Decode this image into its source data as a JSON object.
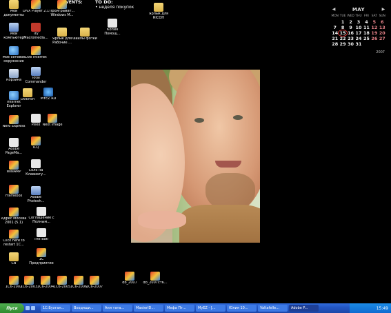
{
  "desktop": {
    "events_label": "EVENTS:",
    "todo_title": "TO DO:",
    "todo_item": "• неделя покупок",
    "icons": [
      {
        "label": "Мои документы",
        "name": "my-documents-icon",
        "type": "folder"
      },
      {
        "label": "DivX Player 2.1",
        "name": "divx-player-icon",
        "type": "app"
      },
      {
        "label": "Проигрыват... Windows M...",
        "name": "windows-media-player-icon",
        "type": "app"
      },
      {
        "label": "Мой компьютер",
        "name": "my-computer-icon",
        "type": "pc"
      },
      {
        "label": "Try Macromedia...",
        "name": "macromedia-icon",
        "type": "red"
      },
      {
        "label": "Ярлык для Рабочие ...",
        "name": "work-folder-shortcut-icon",
        "type": "folder"
      },
      {
        "label": "Файлы фотки",
        "name": "photos-folder-icon",
        "type": "folder"
      },
      {
        "label": "Копия Помощ...",
        "name": "help-copy-icon",
        "type": "doc"
      },
      {
        "label": "Ярлык для RICOH",
        "name": "ricoh-shortcut-icon",
        "type": "folder"
      },
      {
        "label": "Мое сетевое окружение",
        "name": "network-places-icon",
        "type": "net"
      },
      {
        "label": "Live Internet",
        "name": "live-internet-icon",
        "type": "app"
      },
      {
        "label": "Корзина",
        "name": "recycle-bin-icon",
        "type": "bin"
      },
      {
        "label": "Total Commander",
        "name": "total-commander-icon",
        "type": "pc"
      },
      {
        "label": "Internet Explorer",
        "name": "internet-explorer-icon",
        "type": "net"
      },
      {
        "label": "Dvalnch",
        "name": "dvalnch-folder-icon",
        "type": "folder"
      },
      {
        "label": "MYEZ RU",
        "name": "myez-icon",
        "type": "mac"
      },
      {
        "label": "Nero Express",
        "name": "nero-express-icon",
        "type": "app"
      },
      {
        "label": "Pillex",
        "name": "pillex-icon",
        "type": "doc"
      },
      {
        "label": "Next Image",
        "name": "next-image-icon",
        "type": "app"
      },
      {
        "label": "Adobe PageMa...",
        "name": "adobe-pagemaker-icon",
        "type": "doc"
      },
      {
        "label": "ICQ",
        "name": "icq-icon",
        "type": "app"
      },
      {
        "label": "WINAMP",
        "name": "winamp-icon",
        "type": "app"
      },
      {
        "label": "Соло на Клавиату...",
        "name": "solo-keyboard-icon",
        "type": "doc"
      },
      {
        "label": "Framebox",
        "name": "framebox-icon",
        "type": "app"
      },
      {
        "label": "Adobe Photosh...",
        "name": "adobe-photoshop-icon",
        "type": "pc"
      },
      {
        "label": "Адрес Москва 2001 (5.1)",
        "name": "address-moscow-icon",
        "type": "app"
      },
      {
        "label": "Соглашение с Полным...",
        "name": "agreement-icon",
        "type": "doc"
      },
      {
        "label": "Click here to restart 1C...",
        "name": "restart-1c-icon",
        "type": "app"
      },
      {
        "label": "The Bat!",
        "name": "the-bat-icon",
        "type": "doc"
      },
      {
        "label": "CB",
        "name": "cb-folder-icon",
        "type": "folder"
      },
      {
        "label": "1С Предприятие",
        "name": "1c-enterprise-icon",
        "type": "app"
      },
      {
        "label": "1С6-2002",
        "name": "1c6-2002-icon",
        "type": "app"
      },
      {
        "label": "1С6-2003",
        "name": "1c6-2003-icon",
        "type": "app"
      },
      {
        "label": "1С6-2004",
        "name": "1c6-2004-icon",
        "type": "app"
      },
      {
        "label": "1С6-2005",
        "name": "1c6-2005-icon",
        "type": "app"
      },
      {
        "label": "1С6-2006",
        "name": "1c6-2006-icon",
        "type": "app"
      },
      {
        "label": "1С6-2007",
        "name": "1c6-2007-icon",
        "type": "app"
      },
      {
        "label": "db_2007",
        "name": "db-2007-icon",
        "type": "app"
      },
      {
        "label": "db_2007ст6...",
        "name": "db-2007st6-icon",
        "type": "app"
      }
    ]
  },
  "calendar": {
    "month": "MAY",
    "year": "2007",
    "prev": "◀",
    "next": "▶",
    "weekdays": [
      "MON",
      "TUE",
      "WED",
      "THU",
      "FRI",
      "SAT",
      "SUN"
    ],
    "weeks": [
      [
        "",
        "1",
        "2",
        "3",
        "4",
        "5",
        "6"
      ],
      [
        "7",
        "8",
        "9",
        "10",
        "11",
        "12",
        "13"
      ],
      [
        "14",
        "15",
        "16",
        "17",
        "18",
        "19",
        "20"
      ],
      [
        "21",
        "22",
        "23",
        "24",
        "25",
        "26",
        "27"
      ],
      [
        "28",
        "29",
        "30",
        "31",
        "",
        "",
        ""
      ]
    ],
    "today": "15"
  },
  "taskbar": {
    "start_label": "Пуск",
    "buttons": [
      "1С:Бухгал...",
      "Входящи...",
      "Ани тата...",
      "MasterID...",
      "Мефа Пт...",
      "MyEZ - [...",
      "Юлия 10...",
      "Valtafelle...",
      "Adobe P..."
    ],
    "active_index": 8,
    "clock": "15:49"
  },
  "colors": {
    "taskbar": "#245edb",
    "start": "#3c9a3c",
    "today_ring": "#e23b3b",
    "weekend": "#e8838a"
  }
}
